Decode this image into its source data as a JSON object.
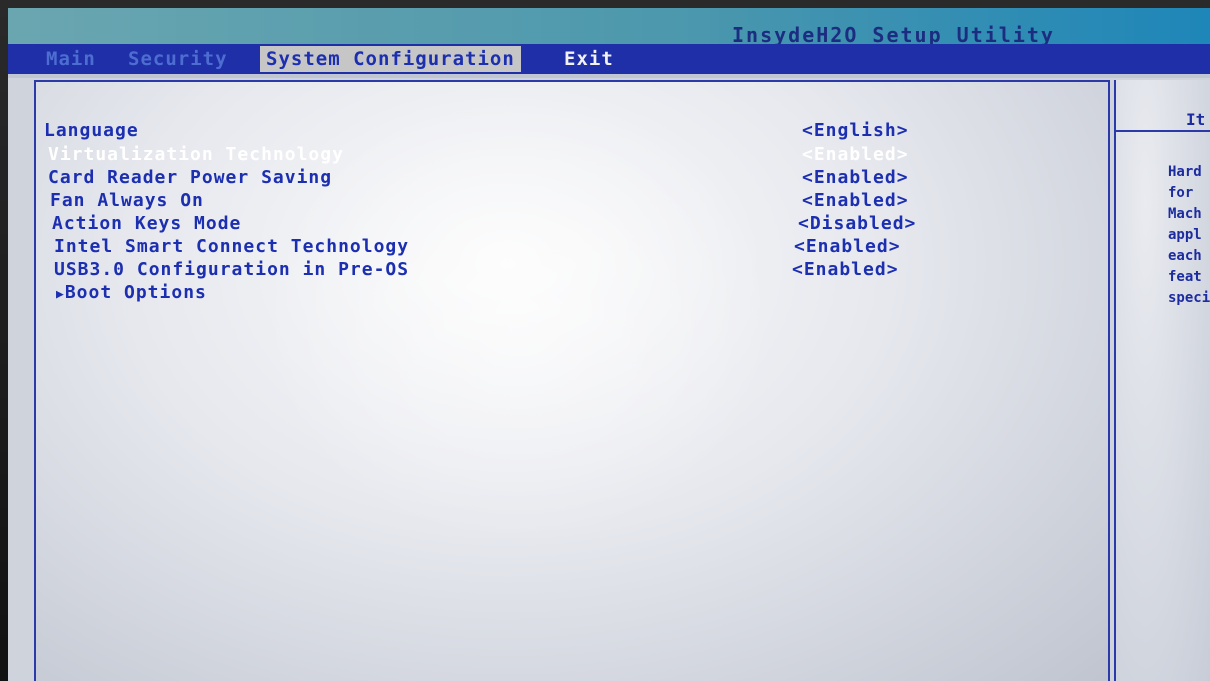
{
  "app_title": "InsydeH2O Setup Utility",
  "menu": {
    "items": [
      {
        "label": "Main"
      },
      {
        "label": "Security"
      },
      {
        "label": "System Configuration"
      },
      {
        "label": "Exit"
      }
    ],
    "selected": "System Configuration"
  },
  "settings": [
    {
      "label": "Language",
      "value": "<English>"
    },
    {
      "label": "Virtualization Technology",
      "value": "<Enabled>",
      "selected": true
    },
    {
      "label": "Card Reader Power Saving",
      "value": "<Enabled>"
    },
    {
      "label": "Fan Always On",
      "value": "<Enabled>"
    },
    {
      "label": "Action Keys Mode",
      "value": "<Disabled>"
    },
    {
      "label": "Intel Smart Connect Technology",
      "value": "<Enabled>"
    },
    {
      "label": "USB3.0 Configuration in Pre-OS",
      "value": "<Enabled>"
    },
    {
      "label": "Boot Options",
      "value": "",
      "submenu_icon": "right-triangle-icon"
    }
  ],
  "help_panel": {
    "header": "It",
    "lines": [
      "Hard",
      "for",
      "Mach",
      "appl",
      "each",
      "feat",
      "speci"
    ]
  },
  "colors": {
    "menu_bar": "#1e2fa8",
    "selected_tab_bg": "#c6c6c6",
    "item_text": "#1c2fb0",
    "selected_text": "#ffffff"
  }
}
